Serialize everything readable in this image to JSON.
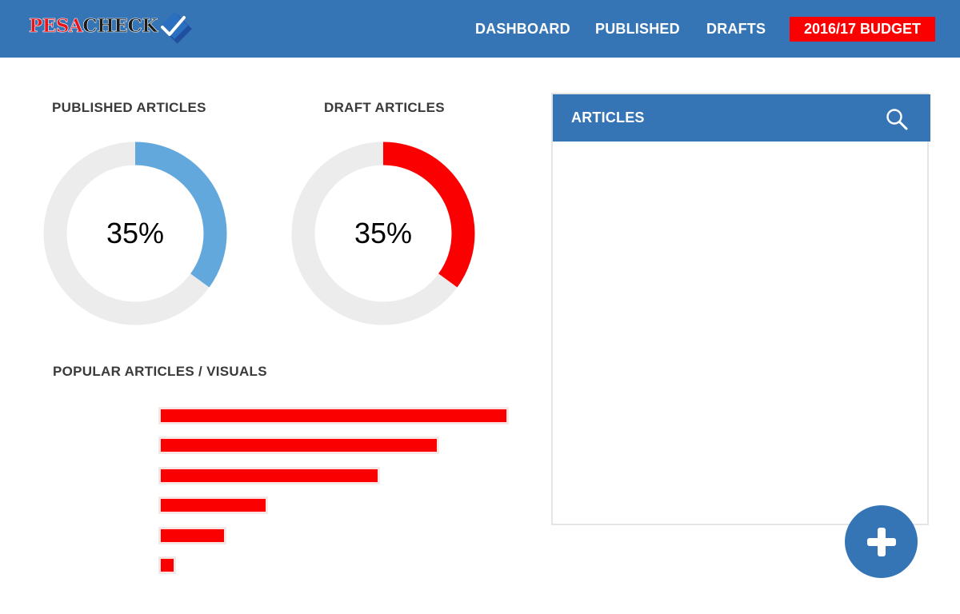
{
  "header": {
    "logo": {
      "part1": "PESA",
      "part2": "CHECK"
    },
    "nav": {
      "dashboard": "DASHBOARD",
      "published": "PUBLISHED",
      "drafts": "DRAFTS",
      "budget": "2016/17 BUDGET"
    }
  },
  "stats": {
    "published": {
      "title": "PUBLISHED ARTICLES",
      "percent": 35,
      "label": "35%",
      "color": "#63a8dc"
    },
    "drafts": {
      "title": "DRAFT ARTICLES",
      "percent": 35,
      "label": "35%",
      "color": "#fb0000"
    }
  },
  "popular": {
    "title": "POPULAR ARTICLES / VISUALS",
    "bar_color": "#fb0000"
  },
  "chart_data": {
    "type": "bar",
    "orientation": "horizontal",
    "values": [
      100,
      80,
      63,
      31,
      19,
      4
    ],
    "xlim": [
      0,
      100
    ],
    "xlabel": "",
    "ylabel": ""
  },
  "articles": {
    "title": "ARTICLES",
    "search_icon": "search-icon"
  },
  "fab": {
    "icon": "plus-icon"
  },
  "colors": {
    "primary": "#3575b5",
    "accent": "#fb0000",
    "published": "#63a8dc",
    "track": "#ececec"
  }
}
